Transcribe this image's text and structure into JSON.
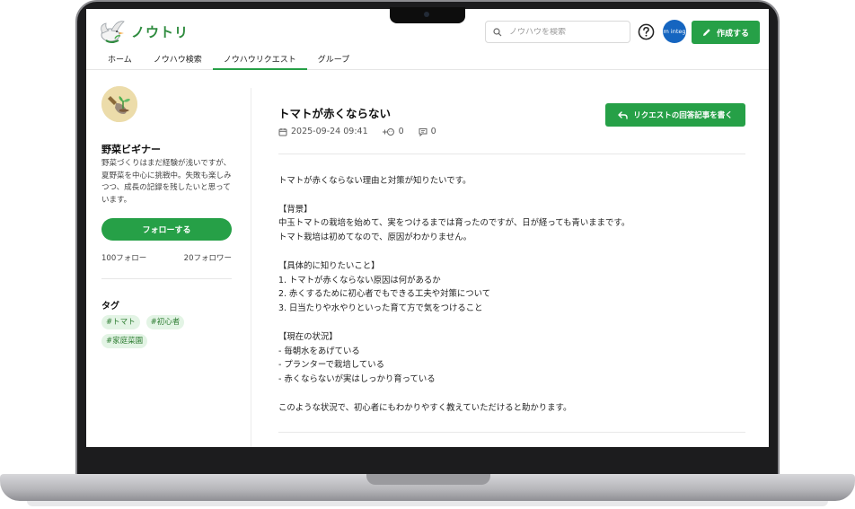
{
  "app": {
    "name": "ノウトリ"
  },
  "search": {
    "placeholder": "ノウハウを検索"
  },
  "header": {
    "avatar_text": "m integ",
    "create_label": "作成する"
  },
  "nav": {
    "tabs": [
      {
        "label": "ホーム"
      },
      {
        "label": "ノウハウ検索"
      },
      {
        "label": "ノウハウリクエスト",
        "active": true
      },
      {
        "label": "グループ"
      }
    ]
  },
  "sidebar": {
    "profile": {
      "name": "野菜ビギナー",
      "bio": "野菜づくりはまだ経験が浅いですが、夏野菜を中心に挑戦中。失敗も楽しみつつ、成長の記録を残したいと思っています。",
      "follow_label": "フォローする",
      "following": "100フォロー",
      "followers": "20フォロワー"
    },
    "tags_title": "タグ",
    "tags": [
      "#トマト",
      "#初心者",
      "#家庭菜園"
    ]
  },
  "post": {
    "title": "トマトが赤くならない",
    "date": "2025-09-24 09:41",
    "reactions": "0",
    "comments": "0",
    "answer_label": "リクエストの回答記事を書く",
    "body": [
      "トマトが赤くならない理由と対策が知りたいです。",
      "【背景】\n中玉トマトの栽培を始めて、実をつけるまでは育ったのですが、日が経っても青いままです。\nトマト栽培は初めてなので、原因がわかりません。",
      "【具体的に知りたいこと】\n1. トマトが赤くならない原因は何があるか\n2. 赤くするために初心者でもできる工夫や対策について\n3. 日当たりや水やりといった育て方で気をつけること",
      "【現在の状況】\n- 毎朝水をあげている\n- プランターで栽培している\n- 赤くならないが実はしっかり育っている",
      "このような状況で、初心者にもわかりやすく教えていただけると助かります。"
    ]
  },
  "colors": {
    "accent": "#26a047",
    "tag_bg": "#e3f4e5",
    "avatar_bg": "#1565c0"
  }
}
